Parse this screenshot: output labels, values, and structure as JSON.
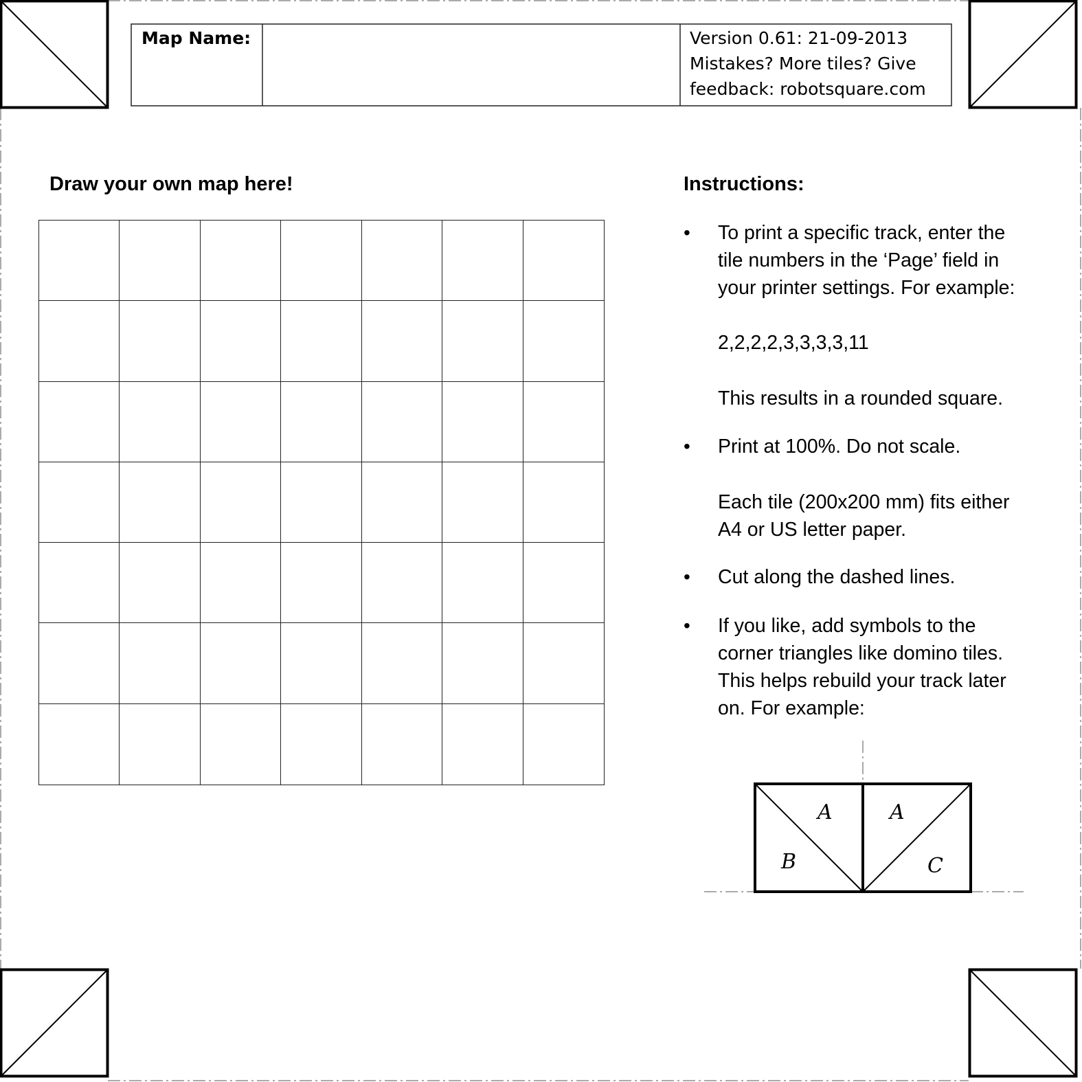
{
  "header": {
    "map_name_label": "Map Name:",
    "map_name_value": "",
    "version_lines": [
      "Version 0.61: 21-09-2013",
      "Mistakes? More tiles? Give",
      "feedback: robotsquare.com"
    ]
  },
  "left": {
    "heading": "Draw your own map here!",
    "grid_rows": 7,
    "grid_cols": 7
  },
  "instructions": {
    "heading": "Instructions:",
    "bullet_symbol": "•",
    "items": [
      {
        "lines": [
          "To print a specific track, enter the",
          "tile numbers in the ‘Page’ field in",
          "your printer settings. For example:"
        ],
        "example": "2,2,2,2,3,3,3,3,11",
        "note": "This results in a rounded square."
      },
      {
        "lines": [
          "Print at 100%. Do not scale."
        ],
        "note_lines": [
          "Each tile (200x200 mm) fits either",
          "A4 or US letter paper."
        ]
      },
      {
        "lines": [
          "Cut along the dashed lines."
        ]
      },
      {
        "lines": [
          "If you like, add symbols to the",
          "corner triangles like domino tiles.",
          "This helps rebuild your track later",
          "on. For example:"
        ]
      }
    ]
  },
  "example_diagram": {
    "left_tile": {
      "top": "A",
      "bottom": "B"
    },
    "right_tile": {
      "top": "A",
      "bottom": "C"
    }
  }
}
